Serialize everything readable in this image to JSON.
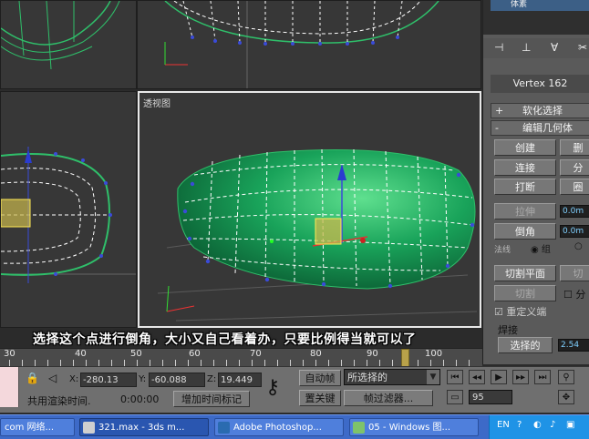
{
  "viewport": {
    "perspective_label": "透视图"
  },
  "subtitle": "选择这个点进行倒角，大小又自己看着办，只要比例得当就可以了",
  "panel": {
    "top_item": "体素",
    "toolbar_icons": [
      "pin-icon",
      "column-icon",
      "funnel-icon",
      "scissors-icon",
      "tools-icon"
    ],
    "vertex_title": "Vertex 162",
    "rollouts": {
      "soft_selection": {
        "toggle": "+",
        "label": "软化选择"
      },
      "edit_geometry": {
        "toggle": "-",
        "label": "编辑几何体"
      }
    },
    "buttons": {
      "create": "创建",
      "delete": "删",
      "connect": "连接",
      "split": "分",
      "break": "打断",
      "ring": "圈",
      "extrude": "拉伸",
      "chamfer": "倒角",
      "slice_plane": "切割平面",
      "cut": "切",
      "slice": "切割",
      "weld_selected": "选择的"
    },
    "spinners": {
      "extrude_value": "0.0m",
      "chamfer_value": "0.0m",
      "weld_value": "2.54"
    },
    "radio_labels": {
      "left": "法线",
      "group": "组"
    },
    "checkboxes": {
      "split": "分",
      "refine_ends": "重定义端"
    },
    "weld_label": "焊接"
  },
  "timeline": {
    "ticks": [
      "30",
      "40",
      "50",
      "60",
      "70",
      "80",
      "90",
      "100"
    ],
    "current_frame_fraction": 0.95
  },
  "status": {
    "x_label": "X:",
    "x_value": "-280.13",
    "y_label": "Y:",
    "y_value": "-60.088",
    "z_label": "Z:",
    "z_value": "19.449",
    "render_time_label": "共用渲染时间.",
    "render_time_value": "0:00:00",
    "add_time_tag": "增加时间标记",
    "auto_key": "自动帧",
    "set_key": "置关键",
    "selection_dropdown": "所选择的",
    "key_filters": "帧过滤器...",
    "frame_value": "95",
    "colors": {
      "viewport_bg": "#373737",
      "mesh_green": "#19a35a",
      "selection_blue": "#3a4bd8"
    }
  },
  "taskbar": {
    "items": [
      {
        "label": "com 网络..."
      },
      {
        "label": "321.max - 3ds m..."
      },
      {
        "label": "Adobe Photoshop..."
      },
      {
        "label": "05 - Windows 图..."
      }
    ],
    "tray": {
      "lang": "EN"
    }
  }
}
